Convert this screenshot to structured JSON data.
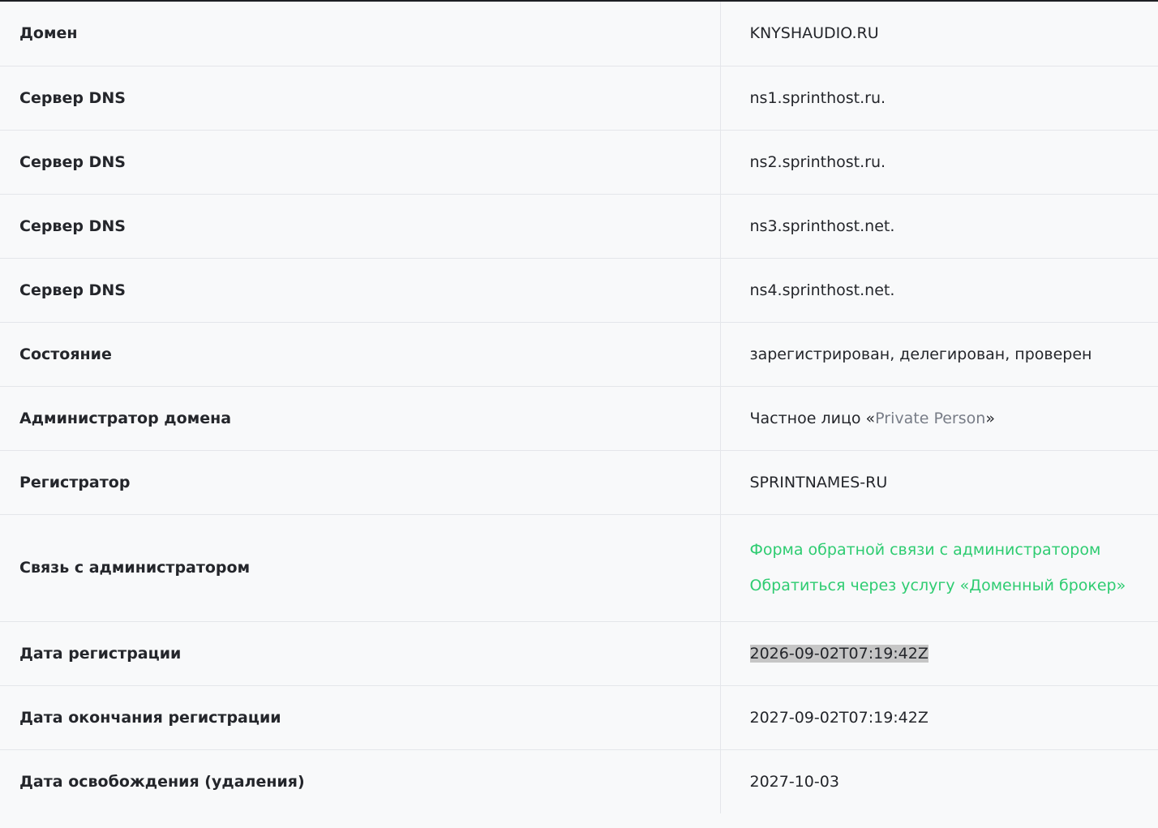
{
  "rows": {
    "domain": {
      "label": "Домен",
      "value": "KNYSHAUDIO.RU"
    },
    "ns1": {
      "label": "Сервер DNS",
      "value": "ns1.sprinthost.ru."
    },
    "ns2": {
      "label": "Сервер DNS",
      "value": "ns2.sprinthost.ru."
    },
    "ns3": {
      "label": "Сервер DNS",
      "value": "ns3.sprinthost.net."
    },
    "ns4": {
      "label": "Сервер DNS",
      "value": "ns4.sprinthost.net."
    },
    "state": {
      "label": "Состояние",
      "value": "зарегистрирован, делегирован, проверен"
    },
    "admin": {
      "label": "Администратор домена",
      "value_prefix": "Частное лицо «",
      "value_name": "Private Person",
      "value_suffix": "»"
    },
    "registrar": {
      "label": "Регистратор",
      "value": "SPRINTNAMES-RU"
    },
    "contact": {
      "label": "Связь с администратором",
      "link_feedback": "Форма обратной связи с администратором",
      "link_broker": "Обратиться через услугу «Доменный брокер»"
    },
    "created": {
      "label": "Дата регистрации",
      "value": "2026-09-02T07:19:42Z"
    },
    "expires": {
      "label": "Дата окончания регистрации",
      "value": "2027-09-02T07:19:42Z"
    },
    "free": {
      "label": "Дата освобождения (удаления)",
      "value": "2027-10-03"
    }
  },
  "colors": {
    "link": "#2ecc71",
    "muted": "#787d87",
    "text": "#24262b",
    "background": "#f8f9fa",
    "selection": "#c6c6c6"
  }
}
